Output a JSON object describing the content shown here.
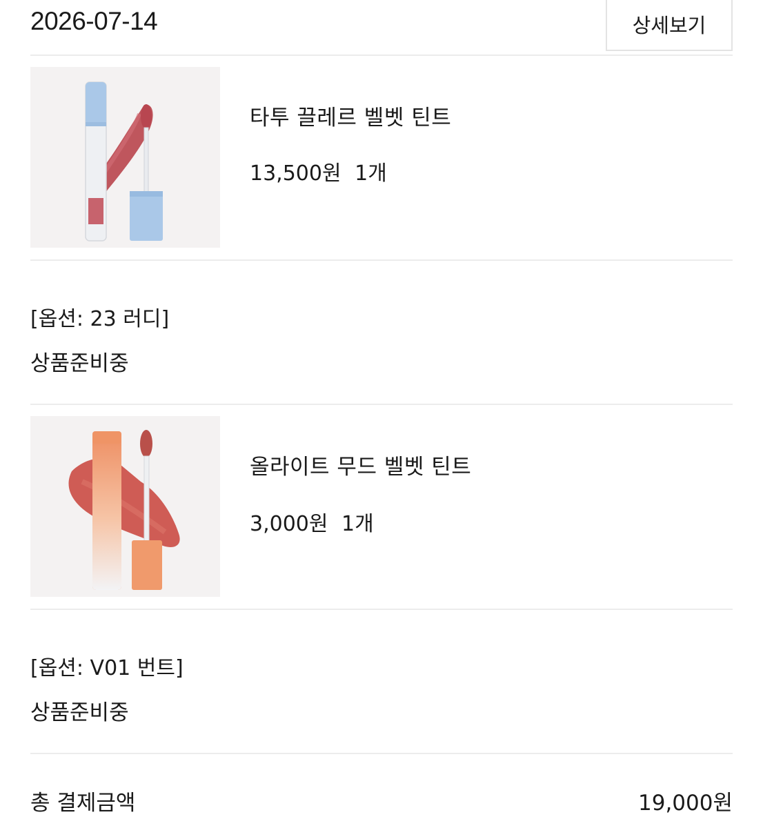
{
  "order": {
    "date": "2026-07-14",
    "detail_button": "상세보기",
    "items": [
      {
        "name": "타투 끌레르 벨벳 틴트",
        "price": "13,500원",
        "quantity": "1개",
        "option": "[옵션: 23 러디]",
        "status": "상품준비중",
        "image_icon": "lip-tint-blue-cap-image"
      },
      {
        "name": "올라이트 무드 벨벳 틴트",
        "price": "3,000원",
        "quantity": "1개",
        "option": "[옵션: V01 번트]",
        "status": "상품준비중",
        "image_icon": "lip-tint-orange-image"
      }
    ],
    "total_label": "총 결제금액",
    "total_value": "19,000원"
  },
  "colors": {
    "divider": "#ececec",
    "text": "#1a1a1a",
    "thumb_bg": "#f4f2f2"
  }
}
